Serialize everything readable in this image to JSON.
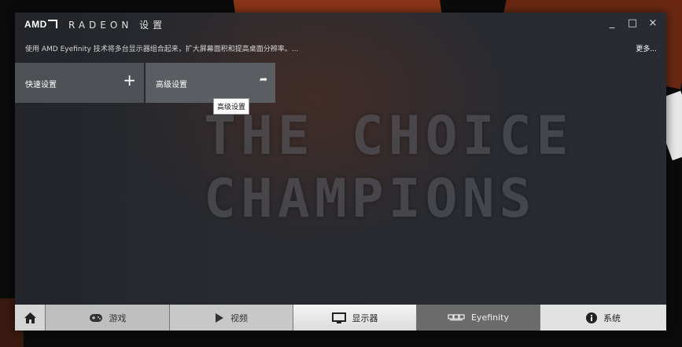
{
  "titlebar": {
    "logo": "AMD",
    "brand": "RADEON 设置",
    "minimize": "_",
    "maximize": "□",
    "close": "×"
  },
  "header": {
    "description": "使用 AMD Eyefinity 技术将多台显示器组合起来，扩大屏幕面积和提高桌面分辨率。...",
    "more": "更多..."
  },
  "tiles": {
    "quick_label": "快速设置",
    "advanced_label": "高级设置"
  },
  "tooltip": "高级设置",
  "background_text": {
    "line1": "THE CHOICE",
    "line2": "CHAMPIONS"
  },
  "bottom_nav": {
    "games": "游戏",
    "video": "视频",
    "display": "显示器",
    "eyefinity": "Eyefinity",
    "system": "系统"
  },
  "icons": {
    "home": "home-icon",
    "games": "gamepad-icon",
    "video": "play-icon",
    "display": "monitor-icon",
    "eyefinity": "multi-monitor-icon",
    "system": "info-icon"
  },
  "colors": {
    "window_bg": "#2a2d33",
    "tile_quick": "#4d5055",
    "tile_advanced": "#5a5d62",
    "nav_active": "#6b6b6b"
  }
}
